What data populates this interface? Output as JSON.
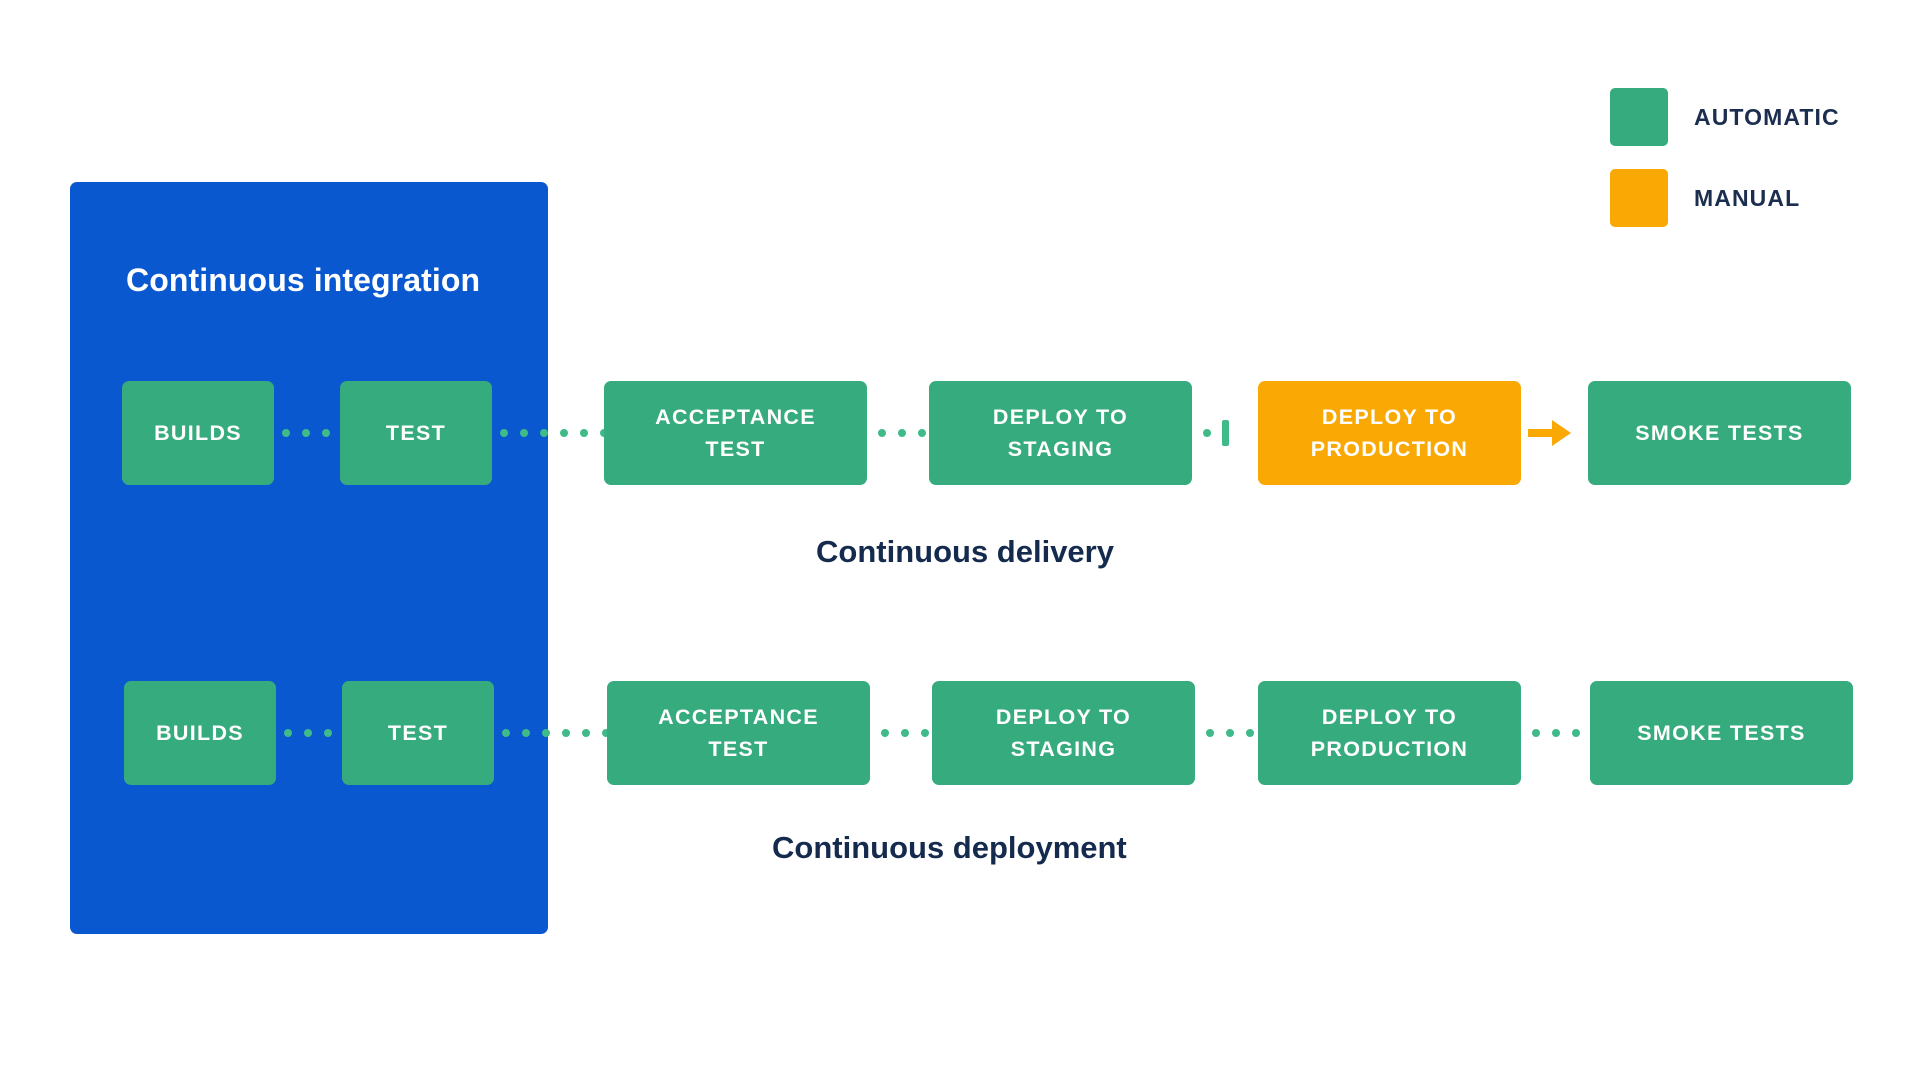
{
  "legend": {
    "items": [
      {
        "label": "AUTOMATIC",
        "color": "#35ab7e",
        "kind": "automatic",
        "icon": "square-swatch-icon"
      },
      {
        "label": "MANUAL",
        "color": "#faa804",
        "kind": "manual",
        "icon": "square-swatch-icon"
      }
    ]
  },
  "ci_panel": {
    "title": "Continuous integration",
    "color": "#0a58d0"
  },
  "colors": {
    "automatic_green": "#35ab7e",
    "manual_orange": "#faa804",
    "ci_blue": "#0a58d0",
    "dot_green": "#3fba89",
    "text_navy": "#152b4e",
    "background": "#ffffff"
  },
  "pipelines": [
    {
      "id": "continuous-delivery",
      "caption": "Continuous delivery",
      "stages": [
        {
          "label": "BUILDS",
          "kind": "automatic"
        },
        {
          "label": "TEST",
          "kind": "automatic"
        },
        {
          "label": "ACCEPTANCE\nTEST",
          "kind": "automatic"
        },
        {
          "label": "DEPLOY TO\nSTAGING",
          "kind": "automatic"
        },
        {
          "label": "DEPLOY TO\nPRODUCTION",
          "kind": "manual"
        },
        {
          "label": "SMOKE TESTS",
          "kind": "automatic"
        }
      ],
      "connectors": [
        "dotted",
        "dotted",
        "dotted",
        "gate",
        "arrow"
      ]
    },
    {
      "id": "continuous-deployment",
      "caption": "Continuous deployment",
      "stages": [
        {
          "label": "BUILDS",
          "kind": "automatic"
        },
        {
          "label": "TEST",
          "kind": "automatic"
        },
        {
          "label": "ACCEPTANCE\nTEST",
          "kind": "automatic"
        },
        {
          "label": "DEPLOY TO\nSTAGING",
          "kind": "automatic"
        },
        {
          "label": "DEPLOY TO\nPRODUCTION",
          "kind": "automatic"
        },
        {
          "label": "SMOKE TESTS",
          "kind": "automatic"
        }
      ],
      "connectors": [
        "dotted",
        "dotted",
        "dotted",
        "dotted",
        "dotted"
      ]
    }
  ]
}
